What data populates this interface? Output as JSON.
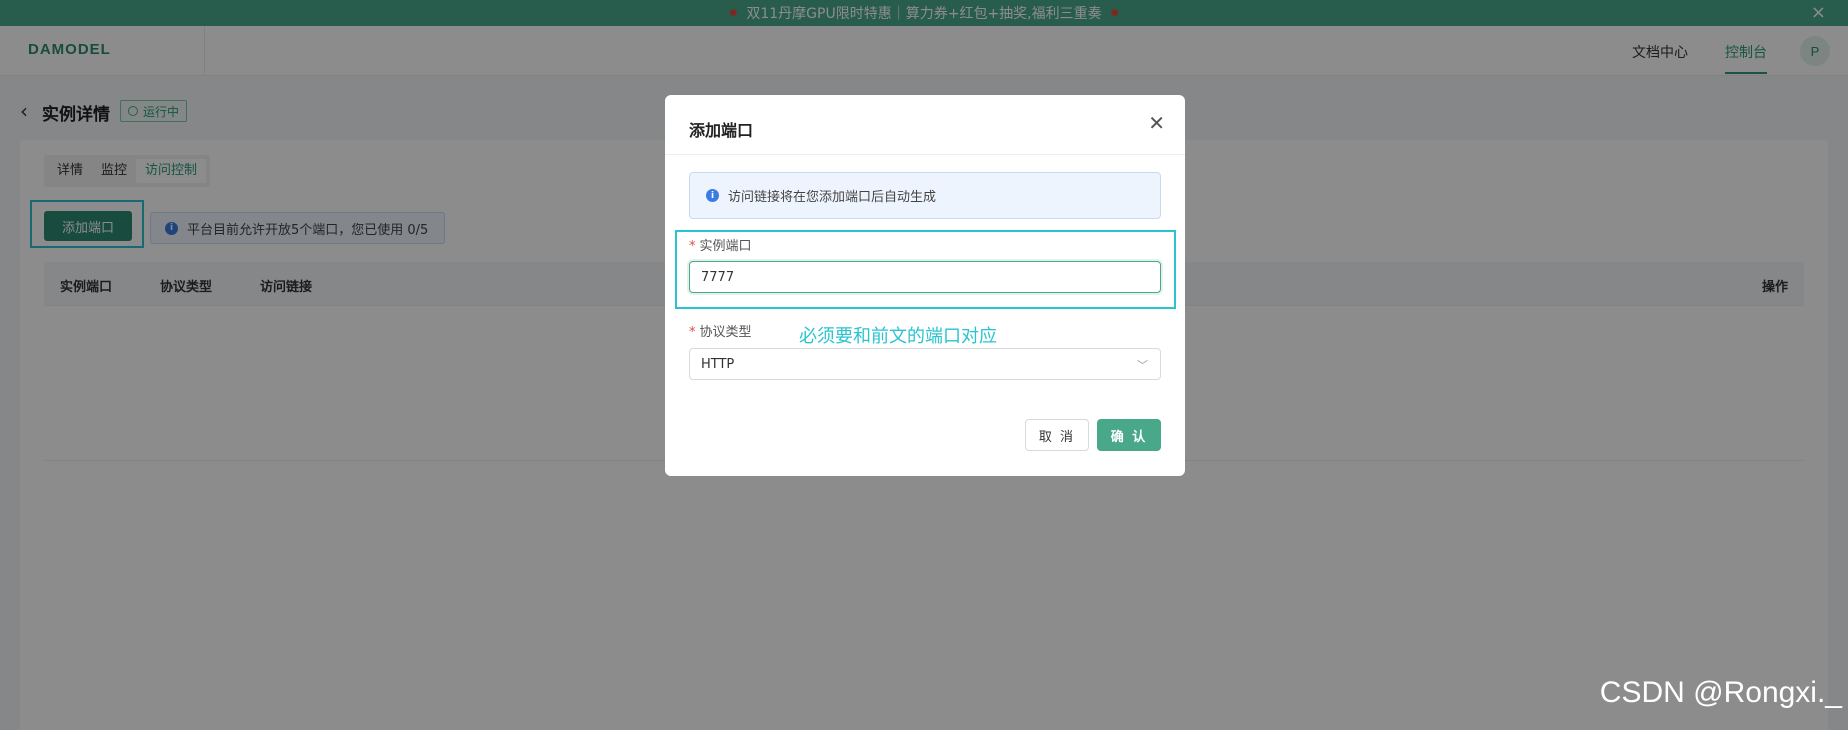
{
  "banner": {
    "text": "双11丹摩GPU限时特惠｜算力券+红包+抽奖,福利三重奏",
    "close": "×"
  },
  "header": {
    "logo": "DAMODEL",
    "nav_doc": "文档中心",
    "nav_console": "控制台",
    "avatar": "P"
  },
  "page": {
    "back": "‹",
    "title": "实例详情",
    "status": "运行中"
  },
  "tabs": [
    "详情",
    "监控",
    "访问控制"
  ],
  "toolbar": {
    "add_button": "添加端口",
    "limit_info": "平台目前允许开放5个端口，您已使用 0/5"
  },
  "table": {
    "columns": [
      "实例端口",
      "协议类型",
      "访问链接",
      "操作"
    ]
  },
  "modal": {
    "title": "添加端口",
    "close": "✕",
    "info": "访问链接将在您添加端口后自动生成",
    "port_label": "实例端口",
    "port_value": "7777",
    "protocol_label": "协议类型",
    "protocol_value": "HTTP",
    "annotation": "必须要和前文的端口对应",
    "cancel": "取 消",
    "confirm": "确 认"
  },
  "watermark": "CSDN @Rongxi._",
  "colors": {
    "brand": "#2a8a73",
    "accent": "#4aa88a",
    "highlight": "#29c4d0",
    "required": "#e6483e"
  }
}
